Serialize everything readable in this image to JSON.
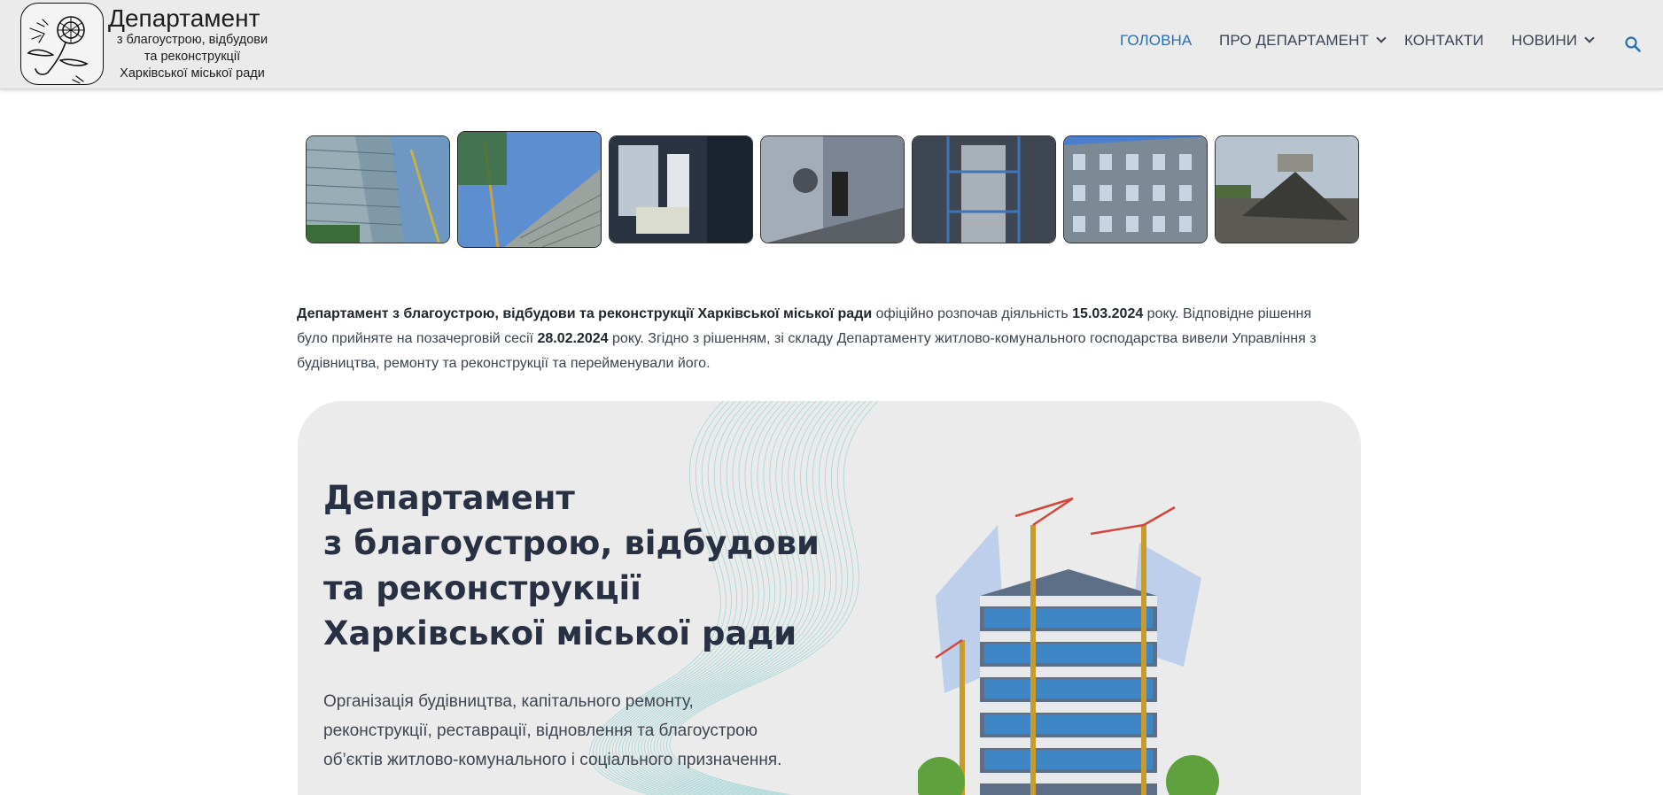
{
  "header": {
    "logo_title": "Департамент",
    "logo_sub_lines": [
      "з благоустрою, відбудови",
      "та реконструкції",
      "Харківської міської ради"
    ]
  },
  "nav": {
    "items": [
      {
        "label": "ГОЛОВНА"
      },
      {
        "label": "ПРО ДЕПАРТАМЕНТ"
      },
      {
        "label": "КОНТАКТИ"
      },
      {
        "label": "НОВИНИ"
      }
    ],
    "active_color": "#2a6fb0",
    "search_icon": "search-icon"
  },
  "gallery": {
    "count": 7,
    "selected_index": 1
  },
  "intro": {
    "p1_bold_org": "Департамент з благоустрою, відбудови та реконструкції Харківської міської ради",
    "p1_text1": " офіційно розпочав діяльність ",
    "p1_bold_date1": "15.03.2024",
    "p1_text2": " року. Відповідне рішення було прийняте на позачерговій сесії ",
    "p1_bold_date2": "28.02.2024",
    "p1_text3": " року. Згідно з рішенням, зі складу Департаменту житлово-комунального господарства вивели Управління з будівництва, ремонту та реконструкції та перейменували його."
  },
  "hero": {
    "title_lines": [
      "Департамент",
      "з благоустрою, відбудови",
      "та реконструкції",
      "Харківської міської ради"
    ],
    "desc_lines": [
      "Організація будівництва, капітального ремонту,",
      "реконструкції, реставрації, відновлення та благоустрою",
      "об’єктів житлово-комунального і соціального призначення."
    ]
  },
  "colors": {
    "header_bg": "#ebebeb",
    "card_bg": "#ebebeb",
    "heading": "#283043",
    "wave": "#8ccfcf"
  }
}
